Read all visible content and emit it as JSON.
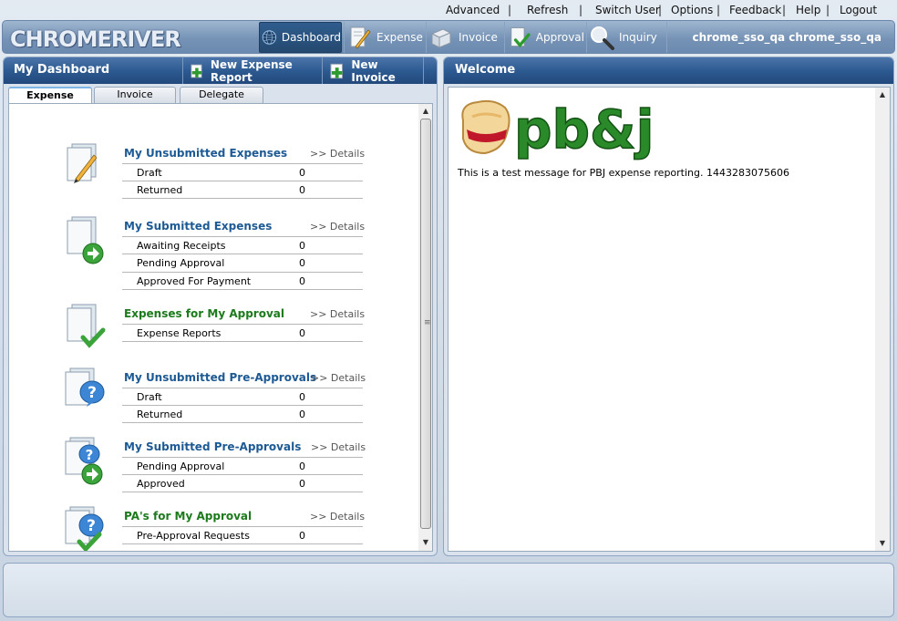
{
  "toplinks": [
    "Advanced",
    "Refresh",
    "Switch User",
    "Options",
    "Feedback",
    "Help",
    "Logout"
  ],
  "logo": {
    "text": "CHROMERIVER"
  },
  "nav": [
    {
      "label": "Dashboard",
      "icon": "globe-icon",
      "selected": true
    },
    {
      "label": "Expense",
      "icon": "pencil-document-icon",
      "selected": false
    },
    {
      "label": "Invoice",
      "icon": "invoice-document-icon",
      "selected": false
    },
    {
      "label": "Approval",
      "icon": "approval-check-icon",
      "selected": false
    },
    {
      "label": "Inquiry",
      "icon": "magnifier-icon",
      "selected": false
    }
  ],
  "user": "chrome_sso_qa chrome_sso_qa",
  "dashboard": {
    "title": "My Dashboard",
    "buttons": {
      "new_expense": "New Expense Report",
      "new_invoice": "New Invoice"
    },
    "tabs": [
      "Expense",
      "Invoice",
      "Delegate"
    ],
    "active_tab": "Expense",
    "details_label": ">> Details",
    "sections": [
      {
        "title": "My Unsubmitted Expenses",
        "green": false,
        "icon": "pencil-document-icon",
        "rows": [
          {
            "label": "Draft",
            "value": "0"
          },
          {
            "label": "Returned",
            "value": "0"
          }
        ]
      },
      {
        "title": "My Submitted Expenses",
        "green": false,
        "icon": "submit-arrow-document-icon",
        "rows": [
          {
            "label": "Awaiting Receipts",
            "value": "0"
          },
          {
            "label": "Pending Approval",
            "value": "0"
          },
          {
            "label": "Approved For Payment",
            "value": "0"
          }
        ]
      },
      {
        "title": "Expenses for My Approval",
        "green": true,
        "icon": "check-document-icon",
        "rows": [
          {
            "label": "Expense Reports",
            "value": "0"
          }
        ]
      },
      {
        "title": "My Unsubmitted Pre-Approvals",
        "green": false,
        "icon": "question-document-icon",
        "rows": [
          {
            "label": "Draft",
            "value": "0"
          },
          {
            "label": "Returned",
            "value": "0"
          }
        ]
      },
      {
        "title": "My Submitted Pre-Approvals",
        "green": false,
        "icon": "question-arrow-document-icon",
        "rows": [
          {
            "label": "Pending Approval",
            "value": "0"
          },
          {
            "label": "Approved",
            "value": "0"
          }
        ]
      },
      {
        "title": "PA's for My Approval",
        "green": true,
        "icon": "question-check-document-icon",
        "rows": [
          {
            "label": "Pre-Approval Requests",
            "value": "0"
          }
        ]
      }
    ]
  },
  "welcome": {
    "title": "Welcome",
    "logo_text": "pb&j",
    "message": "This is a test message for PBJ expense reporting.  1443283075606"
  },
  "colors": {
    "accent_blue": "#1d5a94",
    "accent_green": "#1c7a1c",
    "title_bar": "#2d5a91"
  }
}
